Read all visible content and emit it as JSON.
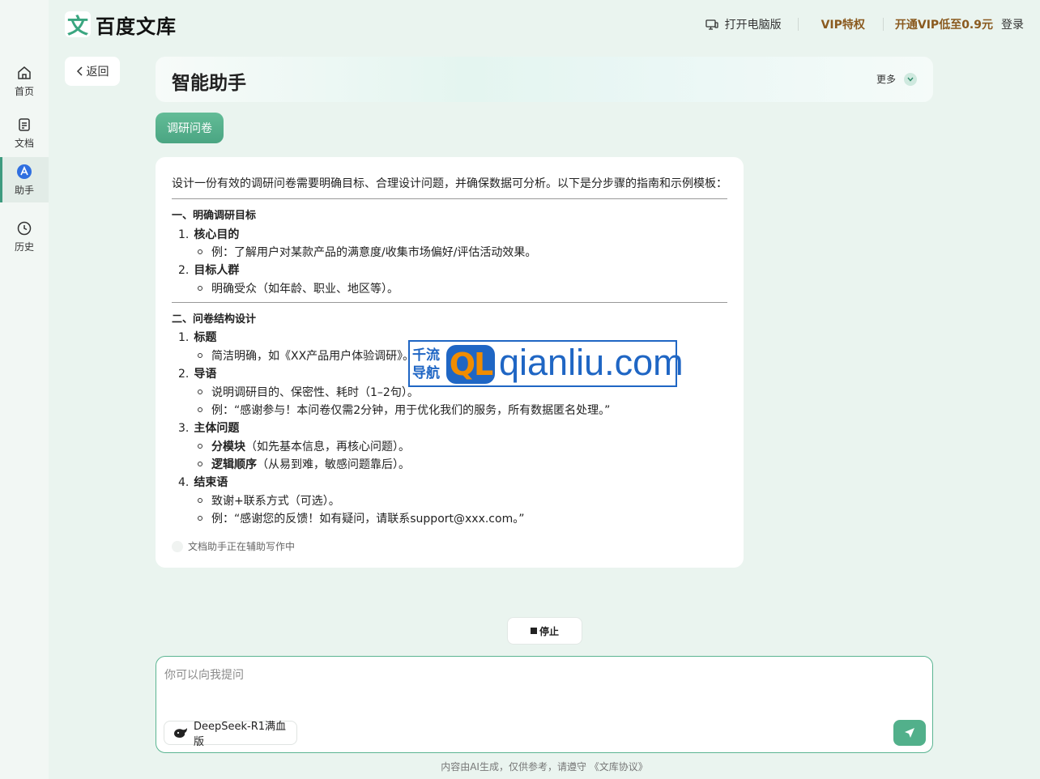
{
  "app": {
    "logo_mark": "文",
    "logo_text": "百度文库"
  },
  "topbar": {
    "pc_label": "打开电脑版",
    "vip_label": "VIP特权",
    "open_vip_label": "开通VIP低至0.9元",
    "login_label": "登录"
  },
  "sidebar": {
    "items": [
      {
        "label": "首页",
        "icon": "home-icon"
      },
      {
        "label": "文档",
        "icon": "document-icon"
      },
      {
        "label": "助手",
        "icon": "assistant-icon"
      },
      {
        "label": "历史",
        "icon": "clock-icon"
      }
    ]
  },
  "back_label": "返回",
  "header": {
    "title": "智能助手",
    "more_label": "更多"
  },
  "tag_label": "调研问卷",
  "answer": {
    "intro": "设计一份有效的调研问卷需要明确目标、合理设计问题，并确保数据可分析。以下是分步骤的指南和示例模板：",
    "section1": {
      "title": "一、明确调研目标",
      "items": [
        {
          "num": "1.",
          "title": "核心目的",
          "bullet": "例：了解用户对某款产品的满意度/收集市场偏好/评估活动效果。"
        },
        {
          "num": "2.",
          "title": "目标人群",
          "bullet": "明确受众（如年龄、职业、地区等）。"
        }
      ]
    },
    "section2": {
      "title": "二、问卷结构设计",
      "items": [
        {
          "num": "1.",
          "title": "标题",
          "bullets": [
            "简洁明确，如《XX产品用户体验调研》。"
          ]
        },
        {
          "num": "2.",
          "title": "导语",
          "bullets": [
            "说明调研目的、保密性、耗时（1–2句）。",
            "例：“感谢参与！本问卷仅需2分钟，用于优化我们的服务，所有数据匿名处理。”"
          ]
        },
        {
          "num": "3.",
          "title": "主体问题",
          "bullets": [
            {
              "bold": "分模块",
              "text": "（如先基本信息，再核心问题）。"
            },
            {
              "bold": "逻辑顺序",
              "text": "（从易到难，敏感问题靠后）。"
            }
          ]
        },
        {
          "num": "4.",
          "title": "结束语",
          "bullets": [
            "致谢+联系方式（可选）。",
            "例：“感谢您的反馈！如有疑问，请联系support@xxx.com。”"
          ]
        }
      ]
    },
    "status": "文档助手正在辅助写作中"
  },
  "watermark": {
    "cn_line1": "千流",
    "cn_line2": "导航",
    "mark": "QL",
    "url": "qianliu.com"
  },
  "stop_label": "停止",
  "input": {
    "placeholder": "你可以向我提问",
    "value": "",
    "model_label": "DeepSeek-R1满血版"
  },
  "footer": "内容由AI生成，仅供参考，请遵守 《文库协议》",
  "colors": {
    "accent": "#4aa582",
    "vip": "#8a5a1f",
    "background": "#eaf4ef"
  }
}
